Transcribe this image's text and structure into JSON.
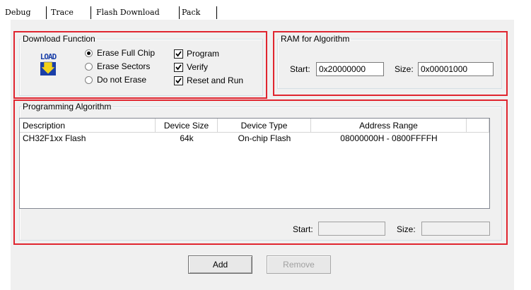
{
  "tabs": [
    {
      "label": "Debug"
    },
    {
      "label": "Trace"
    },
    {
      "label": "Flash Download"
    },
    {
      "label": "Pack"
    }
  ],
  "active_tab": "Flash Download",
  "download_function": {
    "title": "Download Function",
    "icon_text": "LOAD",
    "radios": [
      {
        "label": "Erase Full Chip",
        "checked": true
      },
      {
        "label": "Erase Sectors",
        "checked": false
      },
      {
        "label": "Do not Erase",
        "checked": false
      }
    ],
    "checks": [
      {
        "label": "Program",
        "checked": true
      },
      {
        "label": "Verify",
        "checked": true
      },
      {
        "label": "Reset and Run",
        "checked": true
      }
    ]
  },
  "ram": {
    "title": "RAM for Algorithm",
    "start_label": "Start:",
    "start_value": "0x20000000",
    "size_label": "Size:",
    "size_value": "0x00001000"
  },
  "programming": {
    "title": "Programming Algorithm",
    "columns": [
      "Description",
      "Device Size",
      "Device Type",
      "Address Range"
    ],
    "rows": [
      {
        "description": "CH32F1xx Flash",
        "size": "64k",
        "type": "On-chip Flash",
        "range": "08000000H - 0800FFFFH"
      }
    ],
    "start_label": "Start:",
    "start_value": "",
    "size_label": "Size:",
    "size_value": ""
  },
  "buttons": {
    "add": "Add",
    "remove": "Remove"
  },
  "colors": {
    "highlight": "#e0252f",
    "panel": "#f0f0f0",
    "icon_blue": "#1a3fa8",
    "icon_yellow": "#f2d21a"
  }
}
